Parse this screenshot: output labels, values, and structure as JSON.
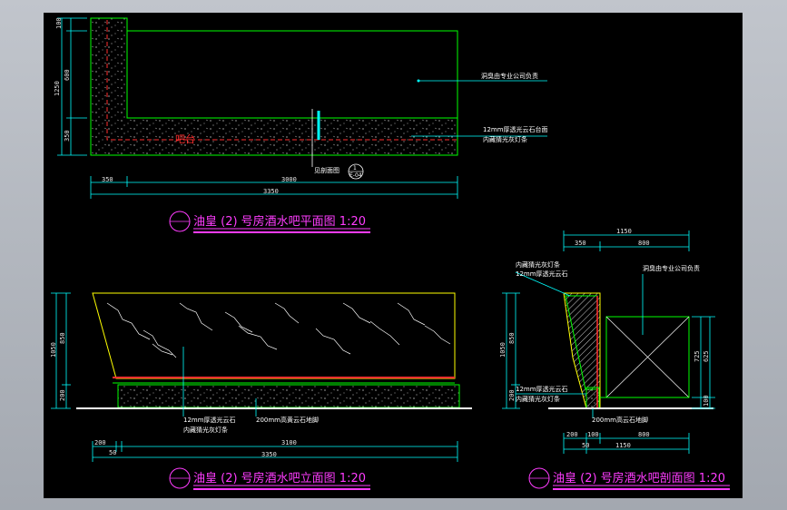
{
  "plan": {
    "title": "油皇 (2) 号房酒水吧平面图  1:20",
    "bar_label": "吧台",
    "note_top": "洞臭由专业公司负责",
    "note_mid_1": "12mm厚透光云石台面",
    "note_mid_2": "内藏猜光灰灯条",
    "section_ref": "见剖面图",
    "dims_h": [
      "350",
      "3000",
      "3350"
    ],
    "dims_v": [
      "100",
      "600",
      "1250",
      "350"
    ],
    "bubble_top": "1",
    "bubble_bottom": "E-04"
  },
  "elevation": {
    "title": "油皇 (2) 号房酒水吧立面图  1:20",
    "note_1": "12mm厚透光云石",
    "note_2": "内藏猜光灰灯条",
    "note_3": "200mm高黄云石地脚",
    "dims_h": [
      "200",
      "50",
      "3100",
      "3350"
    ],
    "dims_v": [
      "1050",
      "850",
      "200"
    ]
  },
  "section": {
    "title": "油皇 (2) 号房酒水吧剖面图  1:20",
    "note_top_1": "内藏猜光灰灯条",
    "note_top_2": "12mm厚透光云石",
    "note_right": "洞臭由专业公司负责",
    "note_mid_1": "12mm厚透光云石",
    "note_mid_2": "内藏猜光灰灯条",
    "note_bottom": "200mm高云石地脚",
    "dims_top": [
      "1150",
      "350",
      "800"
    ],
    "dims_bottom": [
      "200",
      "100",
      "800",
      "50",
      "1150"
    ],
    "dims_v_left": [
      "1050",
      "850",
      "200"
    ],
    "dims_v_right": [
      "725",
      "625",
      "100"
    ]
  },
  "colors": {
    "background": "#000000",
    "outline": "#00ff00",
    "dimension": "#00ffff",
    "title": "#ff3cff",
    "centerline": "#ff3030",
    "marble": "#ffff00"
  }
}
